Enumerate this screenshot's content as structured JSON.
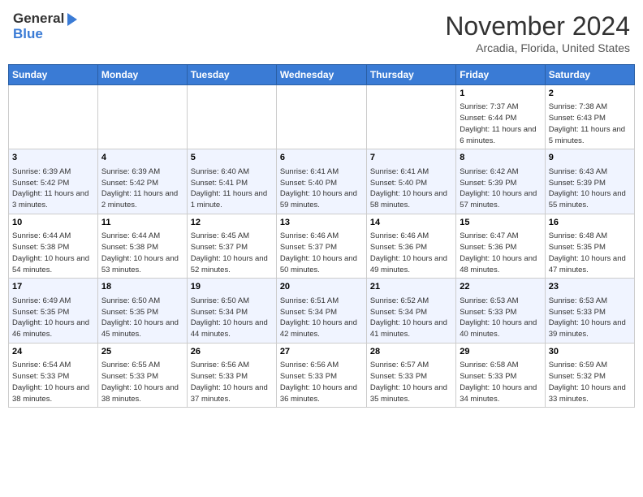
{
  "header": {
    "logo_general": "General",
    "logo_blue": "Blue",
    "month": "November 2024",
    "location": "Arcadia, Florida, United States"
  },
  "days_of_week": [
    "Sunday",
    "Monday",
    "Tuesday",
    "Wednesday",
    "Thursday",
    "Friday",
    "Saturday"
  ],
  "weeks": [
    [
      {
        "day": "",
        "info": ""
      },
      {
        "day": "",
        "info": ""
      },
      {
        "day": "",
        "info": ""
      },
      {
        "day": "",
        "info": ""
      },
      {
        "day": "",
        "info": ""
      },
      {
        "day": "1",
        "info": "Sunrise: 7:37 AM\nSunset: 6:44 PM\nDaylight: 11 hours and 6 minutes."
      },
      {
        "day": "2",
        "info": "Sunrise: 7:38 AM\nSunset: 6:43 PM\nDaylight: 11 hours and 5 minutes."
      }
    ],
    [
      {
        "day": "3",
        "info": "Sunrise: 6:39 AM\nSunset: 5:42 PM\nDaylight: 11 hours and 3 minutes."
      },
      {
        "day": "4",
        "info": "Sunrise: 6:39 AM\nSunset: 5:42 PM\nDaylight: 11 hours and 2 minutes."
      },
      {
        "day": "5",
        "info": "Sunrise: 6:40 AM\nSunset: 5:41 PM\nDaylight: 11 hours and 1 minute."
      },
      {
        "day": "6",
        "info": "Sunrise: 6:41 AM\nSunset: 5:40 PM\nDaylight: 10 hours and 59 minutes."
      },
      {
        "day": "7",
        "info": "Sunrise: 6:41 AM\nSunset: 5:40 PM\nDaylight: 10 hours and 58 minutes."
      },
      {
        "day": "8",
        "info": "Sunrise: 6:42 AM\nSunset: 5:39 PM\nDaylight: 10 hours and 57 minutes."
      },
      {
        "day": "9",
        "info": "Sunrise: 6:43 AM\nSunset: 5:39 PM\nDaylight: 10 hours and 55 minutes."
      }
    ],
    [
      {
        "day": "10",
        "info": "Sunrise: 6:44 AM\nSunset: 5:38 PM\nDaylight: 10 hours and 54 minutes."
      },
      {
        "day": "11",
        "info": "Sunrise: 6:44 AM\nSunset: 5:38 PM\nDaylight: 10 hours and 53 minutes."
      },
      {
        "day": "12",
        "info": "Sunrise: 6:45 AM\nSunset: 5:37 PM\nDaylight: 10 hours and 52 minutes."
      },
      {
        "day": "13",
        "info": "Sunrise: 6:46 AM\nSunset: 5:37 PM\nDaylight: 10 hours and 50 minutes."
      },
      {
        "day": "14",
        "info": "Sunrise: 6:46 AM\nSunset: 5:36 PM\nDaylight: 10 hours and 49 minutes."
      },
      {
        "day": "15",
        "info": "Sunrise: 6:47 AM\nSunset: 5:36 PM\nDaylight: 10 hours and 48 minutes."
      },
      {
        "day": "16",
        "info": "Sunrise: 6:48 AM\nSunset: 5:35 PM\nDaylight: 10 hours and 47 minutes."
      }
    ],
    [
      {
        "day": "17",
        "info": "Sunrise: 6:49 AM\nSunset: 5:35 PM\nDaylight: 10 hours and 46 minutes."
      },
      {
        "day": "18",
        "info": "Sunrise: 6:50 AM\nSunset: 5:35 PM\nDaylight: 10 hours and 45 minutes."
      },
      {
        "day": "19",
        "info": "Sunrise: 6:50 AM\nSunset: 5:34 PM\nDaylight: 10 hours and 44 minutes."
      },
      {
        "day": "20",
        "info": "Sunrise: 6:51 AM\nSunset: 5:34 PM\nDaylight: 10 hours and 42 minutes."
      },
      {
        "day": "21",
        "info": "Sunrise: 6:52 AM\nSunset: 5:34 PM\nDaylight: 10 hours and 41 minutes."
      },
      {
        "day": "22",
        "info": "Sunrise: 6:53 AM\nSunset: 5:33 PM\nDaylight: 10 hours and 40 minutes."
      },
      {
        "day": "23",
        "info": "Sunrise: 6:53 AM\nSunset: 5:33 PM\nDaylight: 10 hours and 39 minutes."
      }
    ],
    [
      {
        "day": "24",
        "info": "Sunrise: 6:54 AM\nSunset: 5:33 PM\nDaylight: 10 hours and 38 minutes."
      },
      {
        "day": "25",
        "info": "Sunrise: 6:55 AM\nSunset: 5:33 PM\nDaylight: 10 hours and 38 minutes."
      },
      {
        "day": "26",
        "info": "Sunrise: 6:56 AM\nSunset: 5:33 PM\nDaylight: 10 hours and 37 minutes."
      },
      {
        "day": "27",
        "info": "Sunrise: 6:56 AM\nSunset: 5:33 PM\nDaylight: 10 hours and 36 minutes."
      },
      {
        "day": "28",
        "info": "Sunrise: 6:57 AM\nSunset: 5:33 PM\nDaylight: 10 hours and 35 minutes."
      },
      {
        "day": "29",
        "info": "Sunrise: 6:58 AM\nSunset: 5:33 PM\nDaylight: 10 hours and 34 minutes."
      },
      {
        "day": "30",
        "info": "Sunrise: 6:59 AM\nSunset: 5:32 PM\nDaylight: 10 hours and 33 minutes."
      }
    ]
  ]
}
